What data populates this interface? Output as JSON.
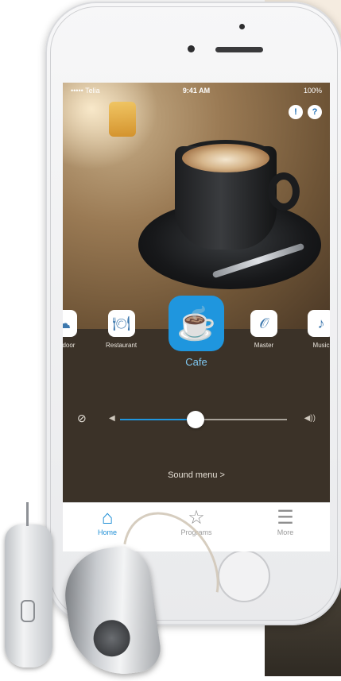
{
  "status_bar": {
    "carrier": "••••• Telia",
    "time": "9:41 AM",
    "battery": "100%"
  },
  "top_icons": {
    "tip_icon": "lightbulb-icon",
    "help_label": "?"
  },
  "programs": [
    {
      "label": "Outdoor",
      "icon": "outdoor-icon",
      "glyph": "☁",
      "active": false
    },
    {
      "label": "Restaurant",
      "icon": "restaurant-icon",
      "glyph": "🍽",
      "active": false
    },
    {
      "label": "Cafe",
      "icon": "coffee-cup-icon",
      "glyph": "☕",
      "active": true
    },
    {
      "label": "Master",
      "icon": "ear-icon",
      "glyph": "𝒪",
      "active": false
    },
    {
      "label": "Music",
      "icon": "music-note-icon",
      "glyph": "♪",
      "active": false
    }
  ],
  "volume": {
    "mute_icon": "speaker-mute-icon",
    "level": 0.45
  },
  "sound_menu_label": "Sound menu >",
  "tabs": [
    {
      "label": "Home",
      "icon": "home-icon",
      "glyph": "⌂",
      "active": true
    },
    {
      "label": "Programs",
      "icon": "star-icon",
      "glyph": "☆",
      "active": false
    },
    {
      "label": "More",
      "icon": "list-icon",
      "glyph": "☰",
      "active": false
    }
  ],
  "colors": {
    "accent": "#1f96de",
    "tab_active": "#1f8fd6"
  }
}
